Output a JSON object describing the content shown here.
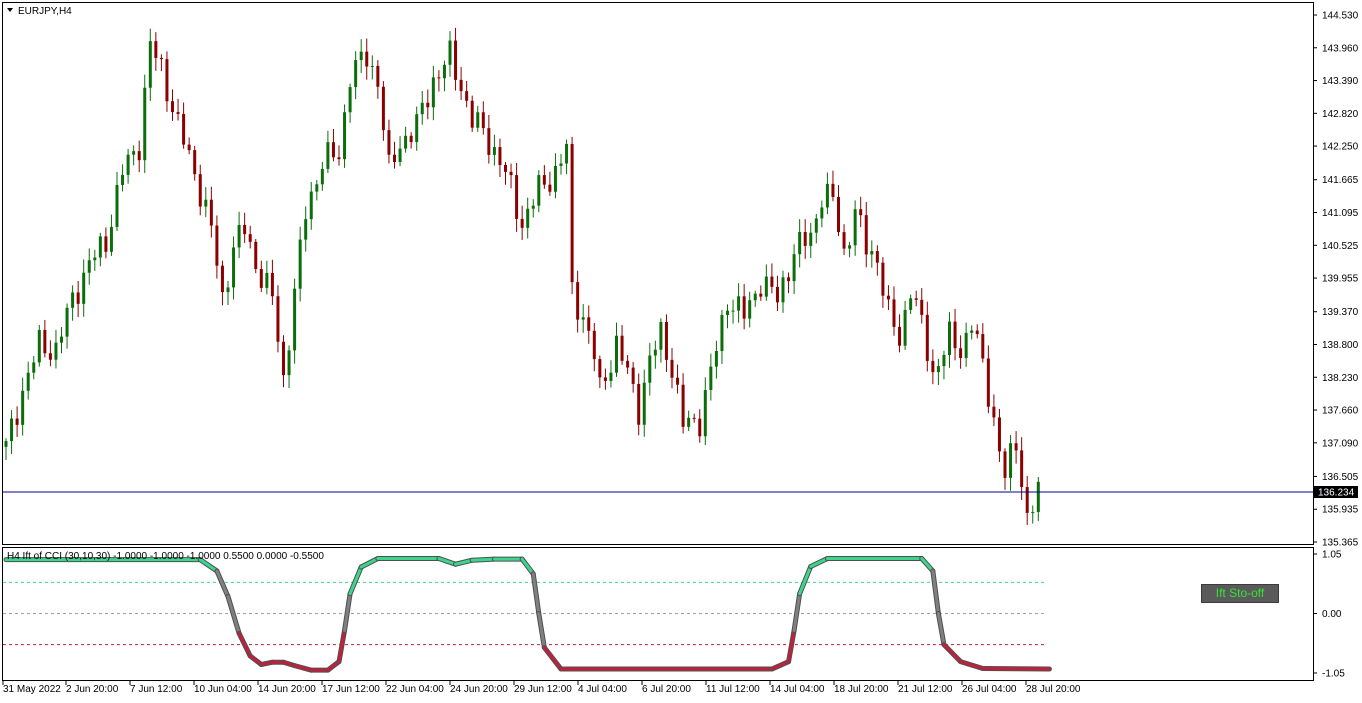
{
  "symbol_label": "EURJPY,H4",
  "indicator_label": "H4 Ift of CCI (30,10,30) -1.0000 -1.0000 -1.0000 0.5500 0.0000 -0.5500",
  "toggle_button": "Ift Sto-off",
  "current_price": "136.234",
  "price_axis": [
    "144.530",
    "143.960",
    "143.390",
    "142.820",
    "142.250",
    "141.665",
    "141.095",
    "140.525",
    "139.955",
    "139.370",
    "138.800",
    "138.230",
    "137.660",
    "137.090",
    "136.505",
    "135.935",
    "135.365"
  ],
  "indicator_axis": [
    "1.05",
    "0.00",
    "-1.05"
  ],
  "time_axis": [
    "31 May 2022",
    "2 Jun 20:00",
    "7 Jun 12:00",
    "10 Jun 04:00",
    "14 Jun 20:00",
    "17 Jun 12:00",
    "22 Jun 04:00",
    "24 Jun 20:00",
    "29 Jun 12:00",
    "4 Jul 04:00",
    "6 Jul 20:00",
    "11 Jul 12:00",
    "14 Jul 04:00",
    "18 Jul 20:00",
    "21 Jul 12:00",
    "26 Jul 04:00",
    "28 Jul 20:00"
  ],
  "colors": {
    "bull": "#0b6e0b",
    "bear": "#8b0000",
    "price_line": "#00008b",
    "ift_up": "#3ad68e",
    "ift_down": "#c0203c",
    "ift_mid": "#808080"
  },
  "chart_data": [
    {
      "type": "candlestick",
      "title": "EURJPY,H4",
      "ylim": [
        135.365,
        144.53
      ],
      "current_price": 136.234,
      "close_path": [
        {
          "x": 0,
          "y": 137.0
        },
        {
          "x": 3,
          "y": 138.0
        },
        {
          "x": 6,
          "y": 138.8
        },
        {
          "x": 9,
          "y": 138.7
        },
        {
          "x": 12,
          "y": 139.6
        },
        {
          "x": 15,
          "y": 140.2
        },
        {
          "x": 18,
          "y": 140.6
        },
        {
          "x": 21,
          "y": 141.8
        },
        {
          "x": 24,
          "y": 142.3
        },
        {
          "x": 26,
          "y": 144.0
        },
        {
          "x": 28,
          "y": 143.6
        },
        {
          "x": 31,
          "y": 142.6
        },
        {
          "x": 34,
          "y": 141.8
        },
        {
          "x": 37,
          "y": 140.8
        },
        {
          "x": 39,
          "y": 139.6
        },
        {
          "x": 41,
          "y": 140.5
        },
        {
          "x": 43,
          "y": 140.8
        },
        {
          "x": 45,
          "y": 140.2
        },
        {
          "x": 48,
          "y": 139.6
        },
        {
          "x": 50,
          "y": 138.2
        },
        {
          "x": 52,
          "y": 139.7
        },
        {
          "x": 54,
          "y": 141.1
        },
        {
          "x": 57,
          "y": 142.0
        },
        {
          "x": 60,
          "y": 142.1
        },
        {
          "x": 62,
          "y": 143.5
        },
        {
          "x": 65,
          "y": 143.8
        },
        {
          "x": 67,
          "y": 143.4
        },
        {
          "x": 69,
          "y": 141.8
        },
        {
          "x": 71,
          "y": 142.3
        },
        {
          "x": 74,
          "y": 142.6
        },
        {
          "x": 77,
          "y": 143.4
        },
        {
          "x": 80,
          "y": 143.8
        },
        {
          "x": 82,
          "y": 143.3
        },
        {
          "x": 84,
          "y": 142.7
        },
        {
          "x": 86,
          "y": 142.5
        },
        {
          "x": 89,
          "y": 142.0
        },
        {
          "x": 91,
          "y": 141.5
        },
        {
          "x": 93,
          "y": 140.9
        },
        {
          "x": 96,
          "y": 141.5
        },
        {
          "x": 99,
          "y": 141.8
        },
        {
          "x": 101,
          "y": 142.2
        },
        {
          "x": 102,
          "y": 139.7
        },
        {
          "x": 104,
          "y": 139.3
        },
        {
          "x": 106,
          "y": 138.6
        },
        {
          "x": 107,
          "y": 138.0
        },
        {
          "x": 110,
          "y": 138.8
        },
        {
          "x": 112,
          "y": 138.3
        },
        {
          "x": 114,
          "y": 137.7
        },
        {
          "x": 116,
          "y": 138.5
        },
        {
          "x": 118,
          "y": 139.0
        },
        {
          "x": 120,
          "y": 138.4
        },
        {
          "x": 122,
          "y": 137.4
        },
        {
          "x": 125,
          "y": 137.5
        },
        {
          "x": 127,
          "y": 138.3
        },
        {
          "x": 130,
          "y": 139.6
        },
        {
          "x": 133,
          "y": 139.3
        },
        {
          "x": 136,
          "y": 139.9
        },
        {
          "x": 139,
          "y": 139.6
        },
        {
          "x": 142,
          "y": 140.4
        },
        {
          "x": 145,
          "y": 140.7
        },
        {
          "x": 147,
          "y": 141.4
        },
        {
          "x": 149,
          "y": 141.3
        },
        {
          "x": 151,
          "y": 140.4
        },
        {
          "x": 153,
          "y": 141.1
        },
        {
          "x": 155,
          "y": 140.5
        },
        {
          "x": 157,
          "y": 140.3
        },
        {
          "x": 159,
          "y": 139.3
        },
        {
          "x": 161,
          "y": 138.9
        },
        {
          "x": 163,
          "y": 139.8
        },
        {
          "x": 165,
          "y": 139.1
        },
        {
          "x": 167,
          "y": 138.3
        },
        {
          "x": 170,
          "y": 138.9
        },
        {
          "x": 172,
          "y": 138.7
        },
        {
          "x": 174,
          "y": 139.2
        },
        {
          "x": 176,
          "y": 138.4
        },
        {
          "x": 178,
          "y": 137.5
        },
        {
          "x": 180,
          "y": 136.5
        },
        {
          "x": 182,
          "y": 137.1
        },
        {
          "x": 184,
          "y": 135.8
        },
        {
          "x": 186,
          "y": 136.2
        }
      ]
    },
    {
      "type": "line",
      "title": "H4 Ift of CCI (30,10,30)",
      "ylim": [
        -1.05,
        1.05
      ],
      "levels": [
        0.55,
        0.0,
        -0.55
      ],
      "points": [
        {
          "x": 0,
          "y": 0.95
        },
        {
          "x": 35,
          "y": 0.95
        },
        {
          "x": 38,
          "y": 0.75
        },
        {
          "x": 40,
          "y": 0.3
        },
        {
          "x": 42,
          "y": -0.35
        },
        {
          "x": 44,
          "y": -0.75
        },
        {
          "x": 46,
          "y": -0.9
        },
        {
          "x": 48,
          "y": -0.86
        },
        {
          "x": 50,
          "y": -0.86
        },
        {
          "x": 52,
          "y": -0.92
        },
        {
          "x": 55,
          "y": -1.0
        },
        {
          "x": 58,
          "y": -1.0
        },
        {
          "x": 60,
          "y": -0.85
        },
        {
          "x": 61,
          "y": -0.3
        },
        {
          "x": 62,
          "y": 0.35
        },
        {
          "x": 64,
          "y": 0.82
        },
        {
          "x": 67,
          "y": 0.97
        },
        {
          "x": 78,
          "y": 0.97
        },
        {
          "x": 81,
          "y": 0.87
        },
        {
          "x": 84,
          "y": 0.94
        },
        {
          "x": 88,
          "y": 0.96
        },
        {
          "x": 93,
          "y": 0.96
        },
        {
          "x": 95,
          "y": 0.7
        },
        {
          "x": 96,
          "y": 0.0
        },
        {
          "x": 97,
          "y": -0.6
        },
        {
          "x": 100,
          "y": -0.98
        },
        {
          "x": 138,
          "y": -0.98
        },
        {
          "x": 141,
          "y": -0.85
        },
        {
          "x": 142,
          "y": -0.3
        },
        {
          "x": 143,
          "y": 0.35
        },
        {
          "x": 145,
          "y": 0.83
        },
        {
          "x": 148,
          "y": 0.97
        },
        {
          "x": 165,
          "y": 0.97
        },
        {
          "x": 167,
          "y": 0.75
        },
        {
          "x": 168,
          "y": 0.0
        },
        {
          "x": 169,
          "y": -0.55
        },
        {
          "x": 172,
          "y": -0.85
        },
        {
          "x": 176,
          "y": -0.97
        },
        {
          "x": 188,
          "y": -0.98
        }
      ]
    }
  ]
}
